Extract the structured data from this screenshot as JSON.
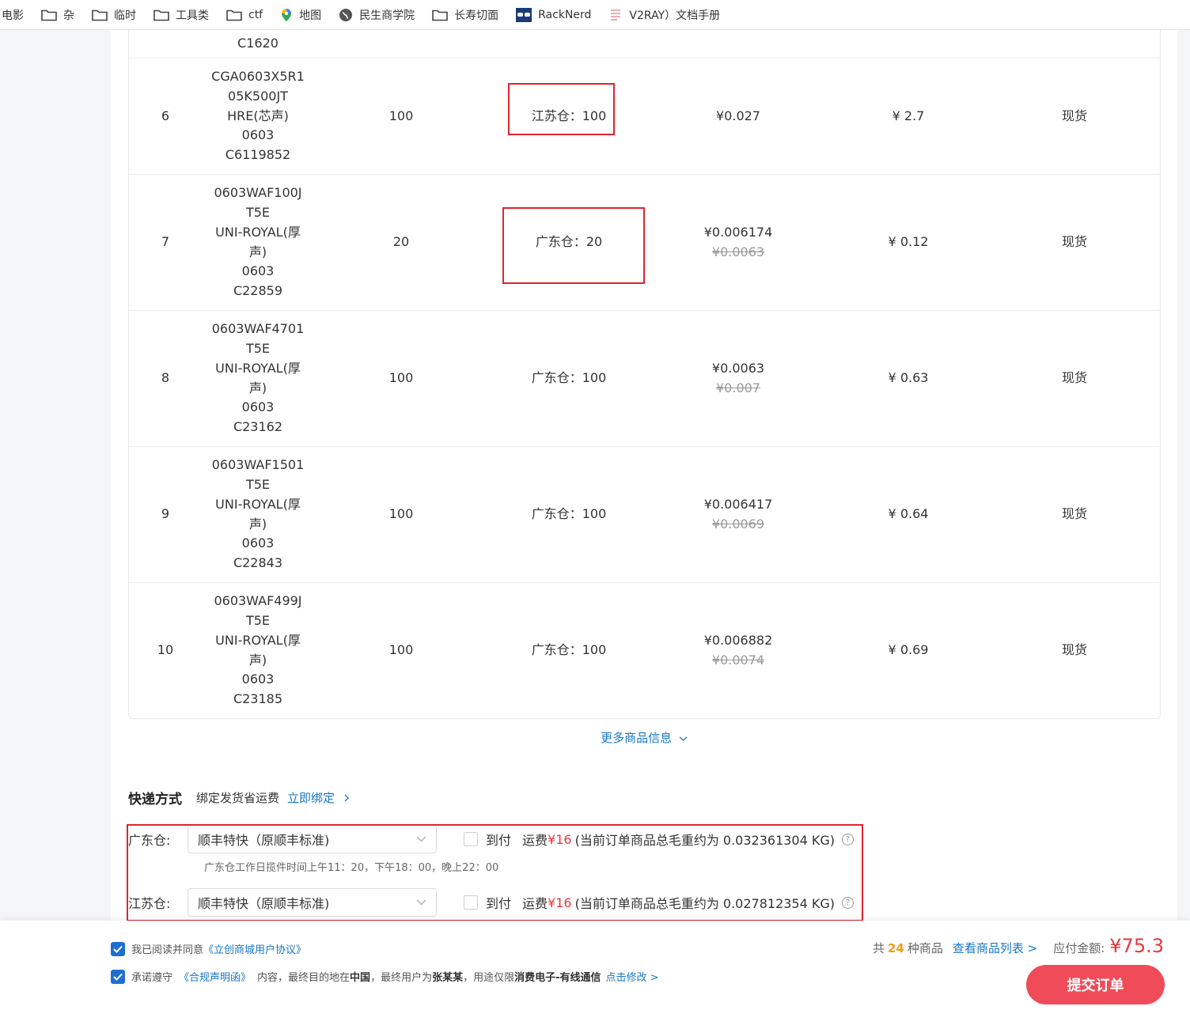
{
  "bookmarks": [
    {
      "label": "电影",
      "icon": "none"
    },
    {
      "label": "杂",
      "icon": "folder-icon"
    },
    {
      "label": "临时",
      "icon": "folder-icon"
    },
    {
      "label": "工具类",
      "icon": "folder-icon"
    },
    {
      "label": "ctf",
      "icon": "folder-icon"
    },
    {
      "label": "地图",
      "icon": "map-pin-icon"
    },
    {
      "label": "民生商学院",
      "icon": "globe-icon"
    },
    {
      "label": "长寿切面",
      "icon": "folder-icon"
    },
    {
      "label": "RackNerd",
      "icon": "racknerd-icon"
    },
    {
      "label": "V2RAY）文档手册",
      "icon": "doc-icon"
    }
  ],
  "table": {
    "prev_row_tail": "C1620",
    "rows": [
      {
        "idx": "6",
        "part": [
          "CGA0603X5R1",
          "05K500JT",
          "HRE(芯声)",
          "0603",
          "C6119852"
        ],
        "qty": "100",
        "warehouse": "江苏仓：100",
        "price": "¥0.027",
        "old_price": "",
        "total": "¥ 2.7",
        "stock": "现货"
      },
      {
        "idx": "7",
        "part": [
          "0603WAF100J",
          "T5E",
          "UNI-ROYAL(厚",
          "声)",
          "0603",
          "C22859"
        ],
        "qty": "20",
        "warehouse": "广东仓：20",
        "price": "¥0.006174",
        "old_price": "¥0.0063",
        "total": "¥ 0.12",
        "stock": "现货"
      },
      {
        "idx": "8",
        "part": [
          "0603WAF4701",
          "T5E",
          "UNI-ROYAL(厚",
          "声)",
          "0603",
          "C23162"
        ],
        "qty": "100",
        "warehouse": "广东仓：100",
        "price": "¥0.0063",
        "old_price": "¥0.007",
        "total": "¥ 0.63",
        "stock": "现货"
      },
      {
        "idx": "9",
        "part": [
          "0603WAF1501",
          "T5E",
          "UNI-ROYAL(厚",
          "声)",
          "0603",
          "C22843"
        ],
        "qty": "100",
        "warehouse": "广东仓：100",
        "price": "¥0.006417",
        "old_price": "¥0.0069",
        "total": "¥ 0.64",
        "stock": "现货"
      },
      {
        "idx": "10",
        "part": [
          "0603WAF499J",
          "T5E",
          "UNI-ROYAL(厚",
          "声)",
          "0603",
          "C23185"
        ],
        "qty": "100",
        "warehouse": "广东仓：100",
        "price": "¥0.006882",
        "old_price": "¥0.0074",
        "total": "¥ 0.69",
        "stock": "现货"
      }
    ]
  },
  "more_info": "更多商品信息",
  "shipping": {
    "title": "快递方式",
    "bind_hint": "绑定发货省运费",
    "bind_link": "立即绑定",
    "warehouses": [
      {
        "label": "广东仓:",
        "method": "顺丰特快（原顺丰标准)",
        "cod": "到付",
        "fee_label": "运费",
        "fee": "¥16",
        "weight": "(当前订单商品总毛重约为 0.032361304 KG)"
      },
      {
        "label": "江苏仓:",
        "method": "顺丰特快（原顺丰标准)",
        "cod": "到付",
        "fee_label": "运费",
        "fee": "¥16",
        "weight": "(当前订单商品总毛重约为 0.027812354 KG)"
      }
    ],
    "note": "广东仓工作日揽件时间上午11：20，下午18：00，晚上22：00"
  },
  "footer": {
    "agree_prefix": "我已阅读并同意",
    "agree_link": "《立创商城用户协议》",
    "comply_prefix": "承诺遵守",
    "comply_link": "《合规声明函》",
    "comply_mid1": "内容，最终目的地在",
    "country": "中国",
    "comply_mid2": "，最终用户为",
    "user": "张某某",
    "comply_mid3": "，用途仅限",
    "usage": "消费电子-有线通信",
    "modify_link": "点击修改 >",
    "count_prefix": "共",
    "count": "24",
    "count_suffix": "种商品",
    "list_link": "查看商品列表 >",
    "amount_label": "应付金额:",
    "amount": "¥75.3",
    "submit": "提交订单"
  },
  "colors": {
    "accent": "#1677c8",
    "danger": "#e5383b",
    "submit_bg": "#f04b58",
    "highlight_border": "#e0242e"
  }
}
